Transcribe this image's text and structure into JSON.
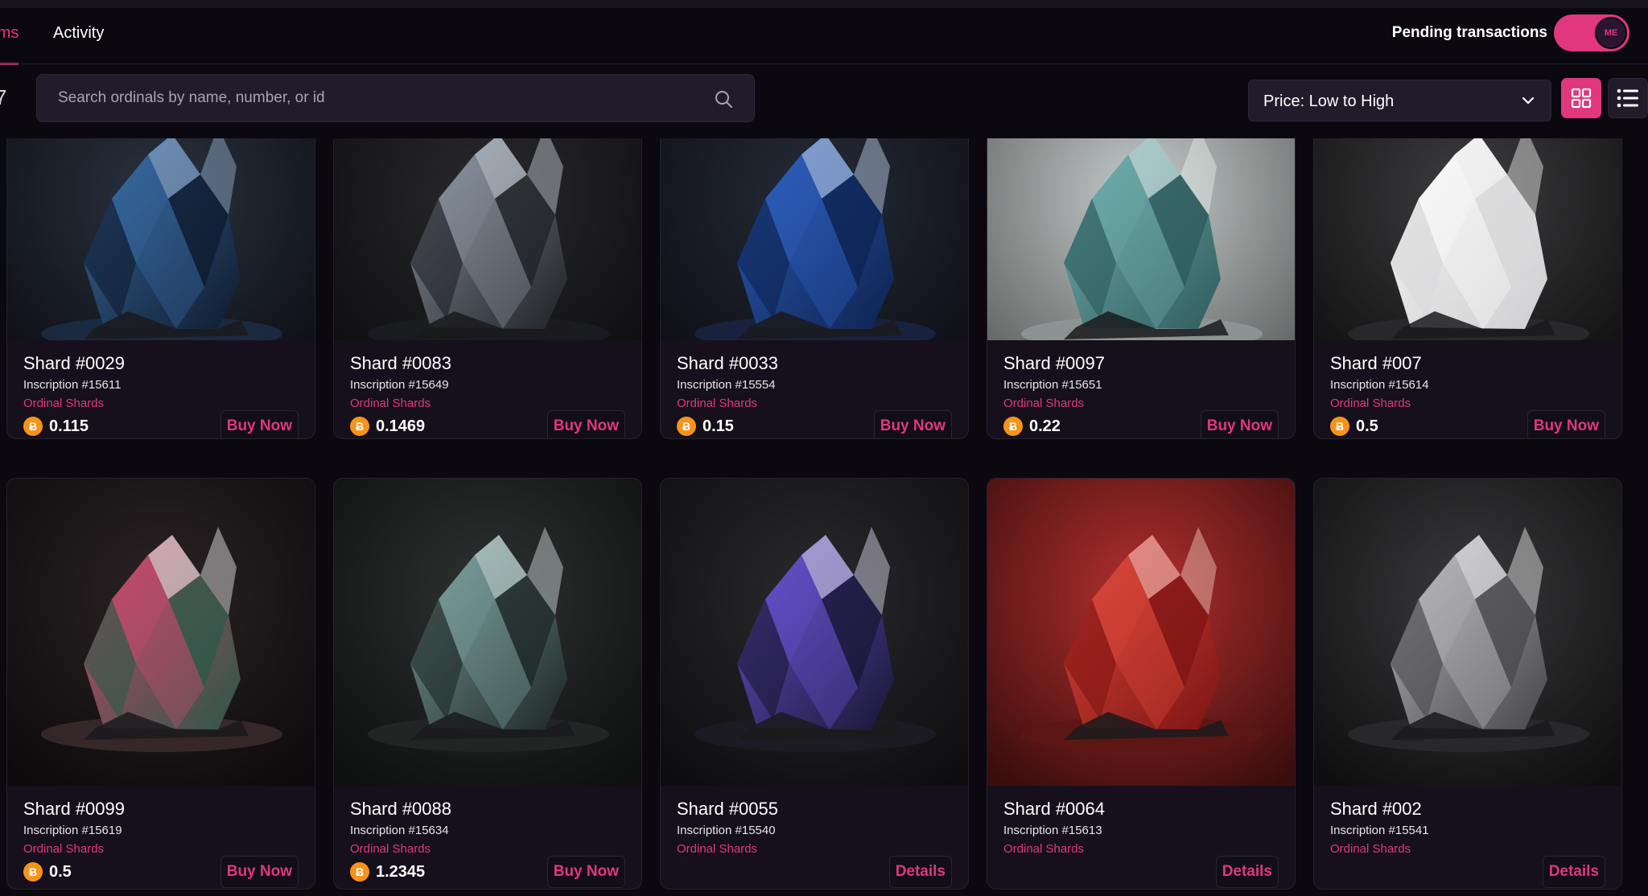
{
  "tabs": {
    "items_label": "tems",
    "activity_label": "Activity"
  },
  "pending": {
    "label": "Pending transactions",
    "toggle_on": true,
    "knob_text": "ME"
  },
  "filter_edge_glyph": "7",
  "search": {
    "placeholder": "Search ordinals by name, number, or id",
    "value": ""
  },
  "sort": {
    "selected": "Price: Low to High"
  },
  "view": {
    "active": "grid"
  },
  "colors": {
    "accent": "#e0377e",
    "background": "#0b0810",
    "card": "#15101b",
    "btc": "#f7931a"
  },
  "cards": [
    {
      "title": "Shard #0029",
      "inscription": "Inscription #15611",
      "collection": "Ordinal Shards",
      "price": "0.115",
      "action": "Buy Now",
      "theme": "blue-dark"
    },
    {
      "title": "Shard #0083",
      "inscription": "Inscription #15649",
      "collection": "Ordinal Shards",
      "price": "0.1469",
      "action": "Buy Now",
      "theme": "gray-dark"
    },
    {
      "title": "Shard #0033",
      "inscription": "Inscription #15554",
      "collection": "Ordinal Shards",
      "price": "0.15",
      "action": "Buy Now",
      "theme": "blue-sparkle"
    },
    {
      "title": "Shard #0097",
      "inscription": "Inscription #15651",
      "collection": "Ordinal Shards",
      "price": "0.22",
      "action": "Buy Now",
      "theme": "teal-misty"
    },
    {
      "title": "Shard #007",
      "inscription": "Inscription #15614",
      "collection": "Ordinal Shards",
      "price": "0.5",
      "action": "Buy Now",
      "theme": "white-crystal"
    },
    {
      "title": "Shard #0099",
      "inscription": "Inscription #15619",
      "collection": "Ordinal Shards",
      "price": "0.5",
      "action": "Buy Now",
      "theme": "iridescent"
    },
    {
      "title": "Shard #0088",
      "inscription": "Inscription #15634",
      "collection": "Ordinal Shards",
      "price": "1.2345",
      "action": "Buy Now",
      "theme": "smoky-rocks"
    },
    {
      "title": "Shard #0055",
      "inscription": "Inscription #15540",
      "collection": "Ordinal Shards",
      "price": "",
      "action": "Details",
      "theme": "purple"
    },
    {
      "title": "Shard #0064",
      "inscription": "Inscription #15613",
      "collection": "Ordinal Shards",
      "price": "",
      "action": "Details",
      "theme": "red"
    },
    {
      "title": "Shard #002",
      "inscription": "Inscription #15541",
      "collection": "Ordinal Shards",
      "price": "",
      "action": "Details",
      "theme": "silver"
    }
  ]
}
